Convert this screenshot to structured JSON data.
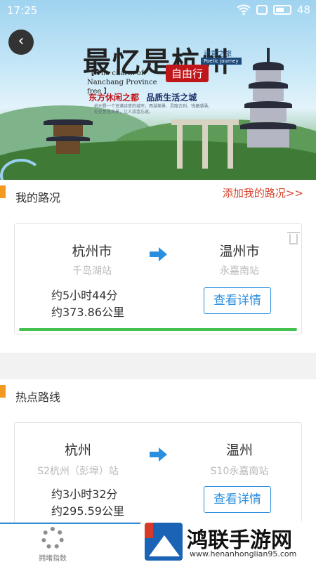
{
  "status_bar": {
    "time": "17:25",
    "battery": "48"
  },
  "banner": {
    "title": "最忆是杭州",
    "subtitle_en": "【 The charm of Nanchang Province free 】",
    "badge": "自由行",
    "tag": "诗意之旅",
    "tag_en": "Poetic journey",
    "slogan_part1": "东方休闲之都",
    "slogan_part2": "品质生活之城",
    "small_text": "杭州是一个充满诗意的城市，西湖美景、灵隐古刹、钱塘潮涌，处处皆是风景，让人流连忘返。"
  },
  "my_routes": {
    "title": "我的路况",
    "add_link": "添加我的路况>>",
    "cards": [
      {
        "from_city": "杭州市",
        "from_station": "千岛湖站",
        "to_city": "温州市",
        "to_station": "永嘉南站",
        "duration": "约5小时44分",
        "distance": "约373.86公里",
        "detail_label": "查看详情",
        "progress": 1.0
      }
    ]
  },
  "hot_routes": {
    "title": "热点路线",
    "cards": [
      {
        "from_city": "杭州",
        "from_station": "S2杭州（彭埠）站",
        "to_city": "温州",
        "to_station": "S10永嘉南站",
        "duration": "约3小时32分",
        "distance": "约295.59公里",
        "detail_label": "查看详情"
      }
    ]
  },
  "bottom_nav": {
    "items": [
      {
        "label": "拥堵指数",
        "icon": "gear-icon"
      }
    ]
  },
  "watermark": {
    "title": "鸿联手游网",
    "url": "www.henanhonglian95.com"
  },
  "colors": {
    "accent": "#2b8fe0",
    "marker": "#f39a1e",
    "link": "#d5402a",
    "progress": "#43c04f"
  }
}
